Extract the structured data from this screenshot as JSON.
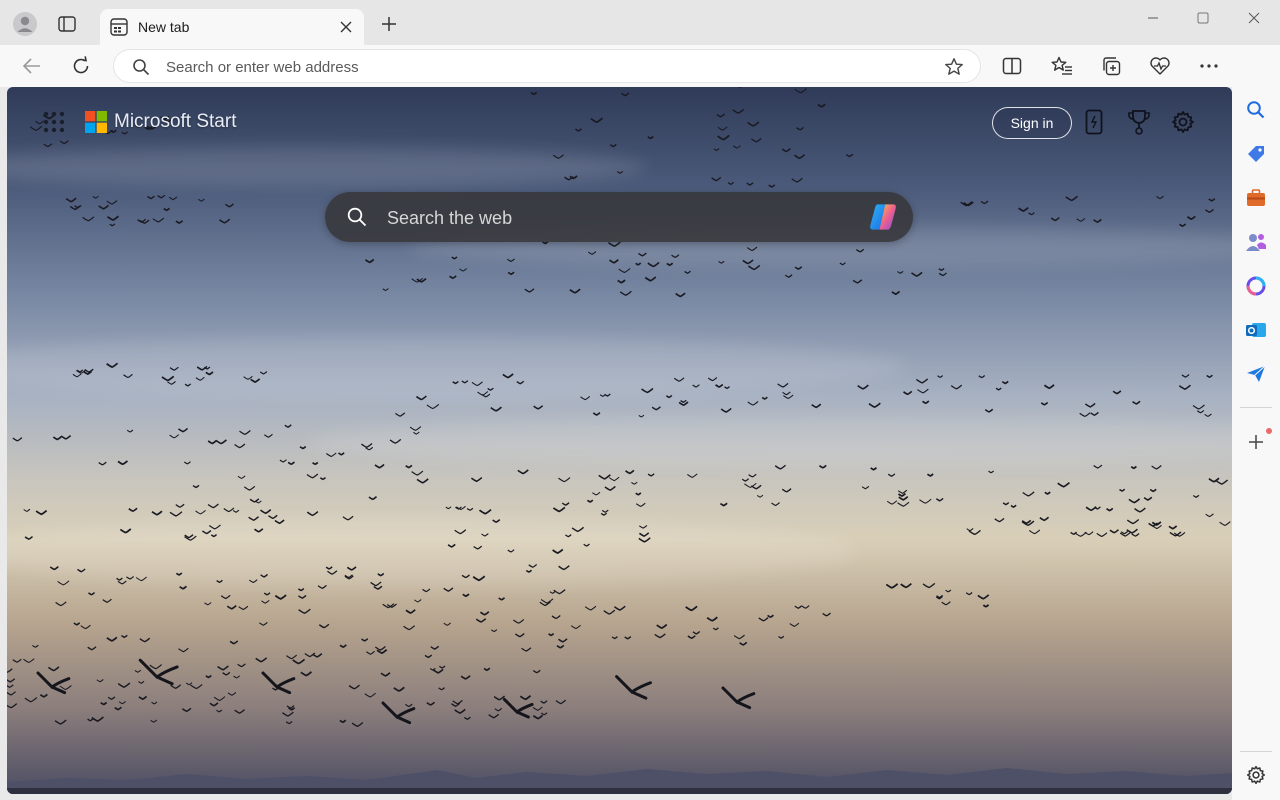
{
  "tab": {
    "title": "New tab"
  },
  "address_bar": {
    "placeholder": "Search or enter web address",
    "value": ""
  },
  "start_page": {
    "brand": "Microsoft Start",
    "sign_in_label": "Sign in",
    "search_placeholder": "Search the web"
  },
  "toolbar_icons": [
    "back-icon",
    "refresh-icon",
    "search-icon",
    "star-icon",
    "split-screen-icon",
    "favorites-icon",
    "collections-icon",
    "browser-essentials-icon",
    "more-icon",
    "copilot-icon"
  ],
  "sidebar_icons": [
    "search-icon",
    "tag-icon",
    "tools-icon",
    "people-icon",
    "copilot-icon",
    "outlook-icon",
    "send-icon",
    "add-icon",
    "settings-icon"
  ],
  "colors": {
    "accent": "#0f6cbd",
    "ms_red": "#f25022",
    "ms_green": "#7fba00",
    "ms_blue": "#00a4ef",
    "ms_yellow": "#ffb900"
  }
}
